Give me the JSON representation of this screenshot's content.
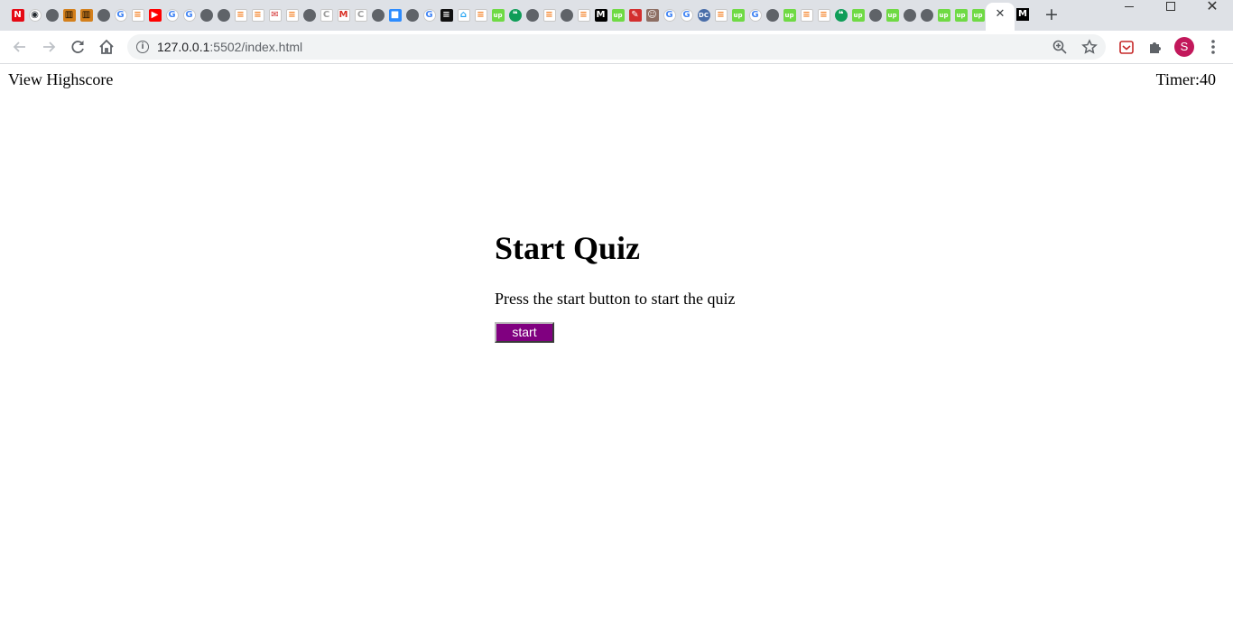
{
  "browser": {
    "url_host": "127.0.0.1",
    "url_path": ":5502/index.html",
    "profile_initial": "S",
    "tabs": [
      {
        "icon": "netflix-icon",
        "glyph": "N",
        "color": "#e50914",
        "text": "#ffffff",
        "round": false
      },
      {
        "icon": "github-icon",
        "glyph": "◉",
        "color": "#ffffff",
        "text": "#24292e",
        "round": true
      },
      {
        "icon": "globe-icon",
        "glyph": "",
        "color": "#5f6368",
        "text": "#ffffff",
        "round": true
      },
      {
        "icon": "bookshelf-icon",
        "glyph": "▥",
        "color": "#d4801c",
        "text": "#000000",
        "round": false
      },
      {
        "icon": "bookshelf-icon",
        "glyph": "▥",
        "color": "#d4801c",
        "text": "#000000",
        "round": false
      },
      {
        "icon": "globe-icon",
        "glyph": "",
        "color": "#5f6368",
        "text": "#ffffff",
        "round": true
      },
      {
        "icon": "google-icon",
        "glyph": "G",
        "color": "#ffffff",
        "text": "#4285f4",
        "round": true
      },
      {
        "icon": "stackoverflow-icon",
        "glyph": "≡",
        "color": "#ffffff",
        "text": "#f48024",
        "round": false
      },
      {
        "icon": "youtube-icon",
        "glyph": "▶",
        "color": "#ff0000",
        "text": "#ffffff",
        "round": false
      },
      {
        "icon": "google-icon",
        "glyph": "G",
        "color": "#ffffff",
        "text": "#4285f4",
        "round": true
      },
      {
        "icon": "google-icon",
        "glyph": "G",
        "color": "#ffffff",
        "text": "#4285f4",
        "round": true
      },
      {
        "icon": "globe-icon",
        "glyph": "",
        "color": "#5f6368",
        "text": "#ffffff",
        "round": true
      },
      {
        "icon": "globe-icon",
        "glyph": "",
        "color": "#5f6368",
        "text": "#ffffff",
        "round": true
      },
      {
        "icon": "stackoverflow-icon",
        "glyph": "≡",
        "color": "#ffffff",
        "text": "#f48024",
        "round": false
      },
      {
        "icon": "stackoverflow-icon",
        "glyph": "≡",
        "color": "#ffffff",
        "text": "#f48024",
        "round": false
      },
      {
        "icon": "mailbox-icon",
        "glyph": "✉",
        "color": "#ffffff",
        "text": "#d32f2f",
        "round": false
      },
      {
        "icon": "stackoverflow-icon",
        "glyph": "≡",
        "color": "#ffffff",
        "text": "#f48024",
        "round": false
      },
      {
        "icon": "globe-icon",
        "glyph": "",
        "color": "#5f6368",
        "text": "#ffffff",
        "round": true
      },
      {
        "icon": "codepen-icon",
        "glyph": "C",
        "color": "#ffffff",
        "text": "#9e9e9e",
        "round": false
      },
      {
        "icon": "gmail-icon",
        "glyph": "M",
        "color": "#ffffff",
        "text": "#d93025",
        "round": false
      },
      {
        "icon": "codepen-icon",
        "glyph": "C",
        "color": "#ffffff",
        "text": "#9e9e9e",
        "round": false
      },
      {
        "icon": "globe-icon",
        "glyph": "",
        "color": "#5f6368",
        "text": "#ffffff",
        "round": true
      },
      {
        "icon": "zoom-app-icon",
        "glyph": "■",
        "color": "#2d8cff",
        "text": "#ffffff",
        "round": false
      },
      {
        "icon": "globe-icon",
        "glyph": "",
        "color": "#5f6368",
        "text": "#ffffff",
        "round": true
      },
      {
        "icon": "google-icon",
        "glyph": "G",
        "color": "#ffffff",
        "text": "#4285f4",
        "round": true
      },
      {
        "icon": "bookmark-app-icon",
        "glyph": "≡",
        "color": "#111111",
        "text": "#ffffff",
        "round": false
      },
      {
        "icon": "bird-icon",
        "glyph": "⌂",
        "color": "#ffffff",
        "text": "#1da1f2",
        "round": false
      },
      {
        "icon": "stackoverflow-icon",
        "glyph": "≡",
        "color": "#ffffff",
        "text": "#f48024",
        "round": false
      },
      {
        "icon": "upwork-icon",
        "glyph": "up",
        "color": "#6fda44",
        "text": "#ffffff",
        "round": false
      },
      {
        "icon": "hangouts-icon",
        "glyph": "❝",
        "color": "#0f9d58",
        "text": "#ffffff",
        "round": true
      },
      {
        "icon": "globe-icon",
        "glyph": "",
        "color": "#5f6368",
        "text": "#ffffff",
        "round": true
      },
      {
        "icon": "stackoverflow-icon",
        "glyph": "≡",
        "color": "#ffffff",
        "text": "#f48024",
        "round": false
      },
      {
        "icon": "globe-icon",
        "glyph": "",
        "color": "#5f6368",
        "text": "#ffffff",
        "round": true
      },
      {
        "icon": "stackoverflow-icon",
        "glyph": "≡",
        "color": "#ffffff",
        "text": "#f48024",
        "round": false
      },
      {
        "icon": "medium-icon",
        "glyph": "M",
        "color": "#000000",
        "text": "#ffffff",
        "round": false
      },
      {
        "icon": "upwork-icon",
        "glyph": "up",
        "color": "#6fda44",
        "text": "#ffffff",
        "round": false
      },
      {
        "icon": "pen-icon",
        "glyph": "✎",
        "color": "#d32f2f",
        "text": "#ffffff",
        "round": false
      },
      {
        "icon": "profile-photo-icon",
        "glyph": "☺",
        "color": "#8d6e63",
        "text": "#ffffff",
        "round": false
      },
      {
        "icon": "google-icon",
        "glyph": "G",
        "color": "#ffffff",
        "text": "#4285f4",
        "round": true
      },
      {
        "icon": "google-icon",
        "glyph": "G",
        "color": "#ffffff",
        "text": "#4285f4",
        "round": true
      },
      {
        "icon": "dc-icon",
        "glyph": "DC",
        "color": "#4a6ea9",
        "text": "#ffffff",
        "round": true
      },
      {
        "icon": "stackoverflow-icon",
        "glyph": "≡",
        "color": "#ffffff",
        "text": "#f48024",
        "round": false
      },
      {
        "icon": "upwork-icon",
        "glyph": "up",
        "color": "#6fda44",
        "text": "#ffffff",
        "round": false
      },
      {
        "icon": "google-icon",
        "glyph": "G",
        "color": "#ffffff",
        "text": "#4285f4",
        "round": true
      },
      {
        "icon": "globe-icon",
        "glyph": "",
        "color": "#5f6368",
        "text": "#ffffff",
        "round": true
      },
      {
        "icon": "upwork-icon",
        "glyph": "up",
        "color": "#6fda44",
        "text": "#ffffff",
        "round": false
      },
      {
        "icon": "stackoverflow-icon",
        "glyph": "≡",
        "color": "#ffffff",
        "text": "#f48024",
        "round": false
      },
      {
        "icon": "stackoverflow-icon",
        "glyph": "≡",
        "color": "#ffffff",
        "text": "#f48024",
        "round": false
      },
      {
        "icon": "hangouts-icon",
        "glyph": "❝",
        "color": "#0f9d58",
        "text": "#ffffff",
        "round": true
      },
      {
        "icon": "upwork-icon",
        "glyph": "up",
        "color": "#6fda44",
        "text": "#ffffff",
        "round": false
      },
      {
        "icon": "globe-icon",
        "glyph": "",
        "color": "#5f6368",
        "text": "#ffffff",
        "round": true
      },
      {
        "icon": "upwork-icon",
        "glyph": "up",
        "color": "#6fda44",
        "text": "#ffffff",
        "round": false
      },
      {
        "icon": "globe-icon",
        "glyph": "",
        "color": "#5f6368",
        "text": "#ffffff",
        "round": true
      },
      {
        "icon": "globe-icon",
        "glyph": "",
        "color": "#5f6368",
        "text": "#ffffff",
        "round": true
      },
      {
        "icon": "upwork-icon",
        "glyph": "up",
        "color": "#6fda44",
        "text": "#ffffff",
        "round": false
      },
      {
        "icon": "upwork-icon",
        "glyph": "up",
        "color": "#6fda44",
        "text": "#ffffff",
        "round": false
      },
      {
        "icon": "upwork-icon",
        "glyph": "up",
        "color": "#6fda44",
        "text": "#ffffff",
        "round": false
      }
    ],
    "active_tab_icon": "close-icon",
    "after_tab_icon": "medium-icon"
  },
  "page": {
    "view_highscore": "View Highscore",
    "timer": "Timer:40",
    "quiz_title": "Start Quiz",
    "quiz_instructions": "Press the start button to start the quiz",
    "start_label": "start"
  },
  "colors": {
    "start_button": "#800080",
    "profile_avatar": "#c2185b"
  }
}
